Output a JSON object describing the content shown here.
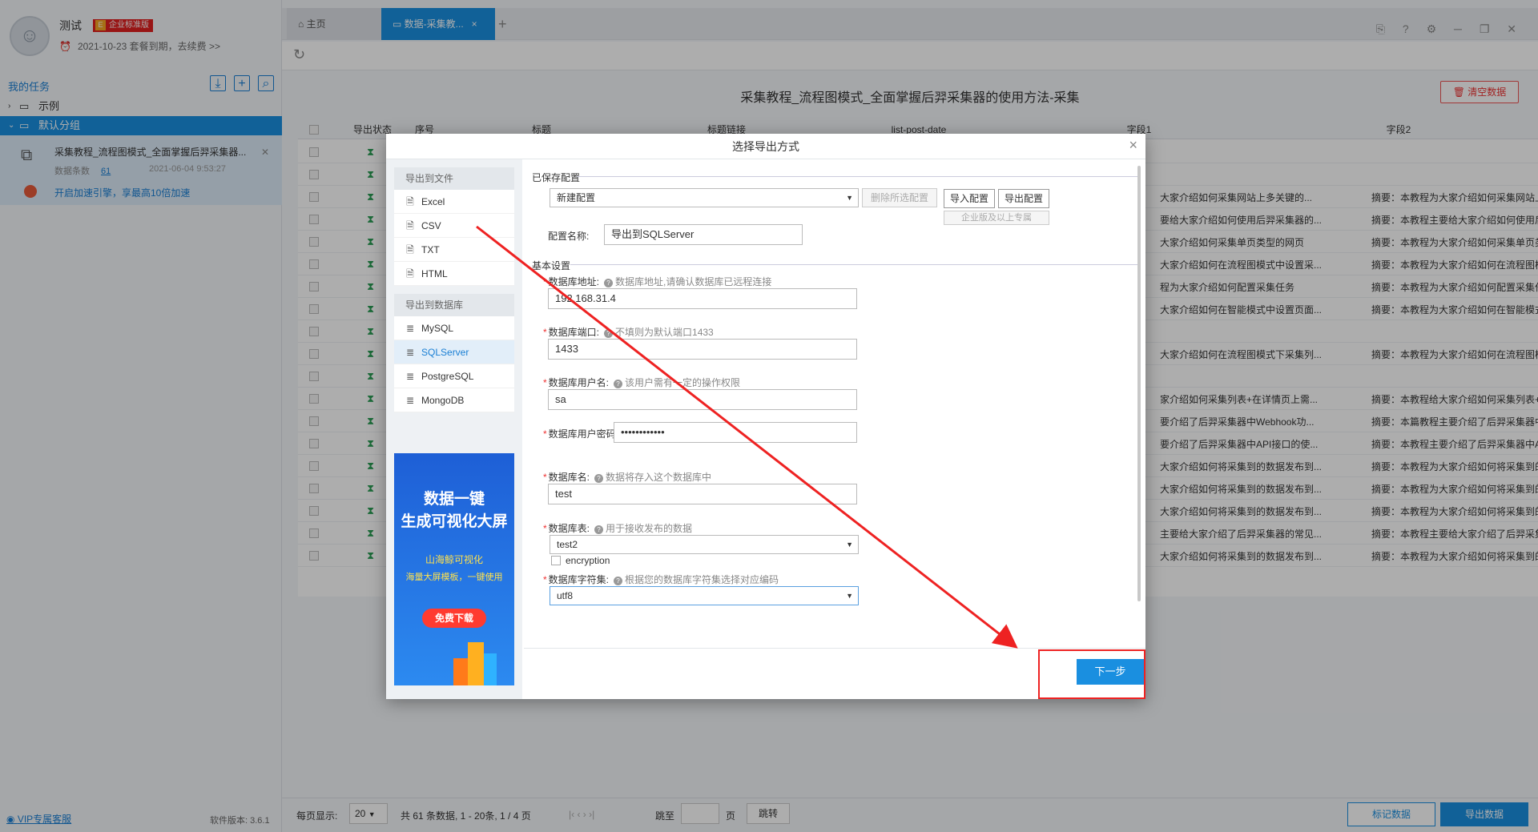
{
  "app": {
    "user": {
      "name": "测试",
      "badge": "企业标准版",
      "badge_icon": "E",
      "expire": "2021-10-23 套餐到期，去续费 >>"
    },
    "colors": {
      "accent": "#1a8fe0",
      "danger": "#ee2222",
      "success": "#2c9d55"
    }
  },
  "sidebar": {
    "header": "我的任务",
    "tree": [
      {
        "arrow": "›",
        "label": "示例"
      },
      {
        "arrow": "⌄",
        "label": "默认分组"
      }
    ],
    "task": {
      "title": "采集教程_流程图模式_全面掌握后羿采集器...",
      "count_label": "数据条数",
      "count": "61",
      "date": "2021-06-04 9:53:27",
      "speed": "开启加速引擎，享最高10倍加速"
    },
    "footer": {
      "vip": "VIP专属客服",
      "version": "软件版本: 3.6.1"
    }
  },
  "tabs": [
    {
      "icon": "home-icon",
      "label": "主页"
    },
    {
      "icon": "table-icon",
      "label": "数据-采集教...",
      "close": "×"
    }
  ],
  "tab_plus": "+",
  "window_controls": "⎘ ? ⚙ ─ ❐ ✕",
  "main": {
    "title": "采集教程_流程图模式_全面掌握后羿采集器的使用方法-采集",
    "clear_button": "清空数据",
    "columns": [
      "导出状态",
      "序号",
      "标题",
      "标题链接",
      "list-post-date",
      "字段1",
      "字段2"
    ],
    "rows": [
      {
        "c1": "",
        "c2": ""
      },
      {
        "c1": "",
        "c2": ""
      },
      {
        "c1": "大家介绍如何采集网站上多关键的...",
        "c2": "摘要：本教程为大家介绍如何采集网站上多关键..."
      },
      {
        "c1": "要给大家介绍如何使用后羿采集器的...",
        "c2": "摘要：本教程主要给大家介绍如何使用后羿采集..."
      },
      {
        "c1": "大家介绍如何采集单页类型的网页",
        "c2": "摘要：本教程为大家介绍如何采集单页类型的网..."
      },
      {
        "c1": "大家介绍如何在流程图模式中设置采...",
        "c2": "摘要：本教程为大家介绍如何在流程图模式中设..."
      },
      {
        "c1": "程为大家介绍如何配置采集任务",
        "c2": "摘要：本教程为大家介绍如何配置采集任务 免..."
      },
      {
        "c1": "大家介绍如何在智能模式中设置页面...",
        "c2": "摘要：本教程为大家介绍如何在智能模式中设置..."
      },
      {
        "c1": "",
        "c2": ""
      },
      {
        "c1": "大家介绍如何在流程图模式下采集列...",
        "c2": "摘要：本教程为大家介绍如何在流程图模式下采..."
      },
      {
        "c1": "",
        "c2": ""
      },
      {
        "c1": "家介绍如何采集列表+在详情页上需...",
        "c2": "摘要：本教程给大家介绍如何采集列表+在详情..."
      },
      {
        "c1": "要介绍了后羿采集器中Webhook功...",
        "c2": "摘要：本篇教程主要介绍了后羿采集器中Webh..."
      },
      {
        "c1": "要介绍了后羿采集器中API接口的使...",
        "c2": "摘要：本教程主要介绍了后羿采集器中API接..."
      },
      {
        "c1": "大家介绍如何将采集到的数据发布到...",
        "c2": "摘要：本教程为大家介绍如何将采集到的数据发..."
      },
      {
        "c1": "大家介绍如何将采集到的数据发布到...",
        "c2": "摘要：本教程为大家介绍如何将采集到的数据发..."
      },
      {
        "c1": "大家介绍如何将采集到的数据发布到...",
        "c2": "摘要：本教程为大家介绍如何将采集到的数据发..."
      },
      {
        "c1": "主要给大家介绍了后羿采集器的常见...",
        "c2": "摘要：本教程主要给大家介绍了后羿采集器的..."
      },
      {
        "c1": "大家介绍如何将采集到的数据发布到...",
        "c2": "摘要：本教程为大家介绍如何将采集到的数据发..."
      }
    ],
    "pager": {
      "per_page_label": "每页显示:",
      "per_page": "20",
      "summary": "共 61 条数据,  1 - 20条,  1  /  4  页",
      "nav": "|‹  ‹  ›  ›|",
      "goto_label": "跳至",
      "page_unit": "页",
      "jump": "跳转",
      "mark": "标记数据",
      "export": "导出数据"
    }
  },
  "dialog": {
    "title": "选择导出方式",
    "close": "×",
    "sections": [
      {
        "label": "导出到文件",
        "items": [
          {
            "icon": "file-icon",
            "glyph": "🗎",
            "label": "Excel"
          },
          {
            "icon": "file-icon",
            "glyph": "🗎",
            "label": "CSV"
          },
          {
            "icon": "file-icon",
            "glyph": "🗎",
            "label": "TXT"
          },
          {
            "icon": "file-icon",
            "glyph": "🗎",
            "label": "HTML"
          }
        ]
      },
      {
        "label": "导出到数据库",
        "items": [
          {
            "icon": "database-icon",
            "glyph": "≣",
            "label": "MySQL"
          },
          {
            "icon": "database-icon",
            "glyph": "≣",
            "label": "SQLServer"
          },
          {
            "icon": "database-icon",
            "glyph": "≣",
            "label": "PostgreSQL"
          },
          {
            "icon": "database-icon",
            "glyph": "≣",
            "label": "MongoDB"
          }
        ]
      }
    ],
    "banner": {
      "line1": "数据一键",
      "line2": "生成可视化大屏",
      "line3": "山海鲸可视化",
      "line4": "海量大屏模板，一键使用",
      "button": "免费下载"
    },
    "saved_config": {
      "header": "已保存配置",
      "select": "新建配置",
      "delete": "删除所选配置",
      "import": "导入配置",
      "export": "导出配置",
      "note": "企业版及以上专属",
      "name_label": "配置名称:",
      "name_value": "导出到SQLServer"
    },
    "basic": {
      "header": "基本设置",
      "fields": [
        {
          "label": "数据库地址:",
          "hint": "数据库地址,请确认数据库已远程连接",
          "value": "192.168.31.4"
        },
        {
          "label": "数据库端口:",
          "hint": "不填则为默认端口1433",
          "value": "1433"
        },
        {
          "label": "数据库用户名:",
          "hint": "该用户需有一定的操作权限",
          "value": "sa"
        },
        {
          "label": "数据库用户密码:",
          "hint": "",
          "value": "••••••••••••"
        },
        {
          "label": "数据库名:",
          "hint": "数据将存入这个数据库中",
          "value": "test"
        },
        {
          "label": "数据库表:",
          "hint": "用于接收发布的数据",
          "value": "test2"
        },
        {
          "label": "数据库字符集:",
          "hint": "根据您的数据库字符集选择对应编码",
          "value": "utf8"
        }
      ],
      "encryption": "encryption"
    },
    "next": "下一步"
  }
}
